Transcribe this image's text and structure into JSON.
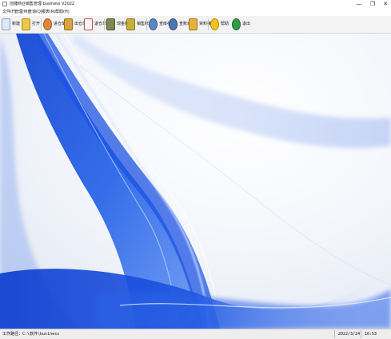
{
  "window": {
    "title": "创捷商业销售管理 business V2022",
    "minimize_glyph": "—",
    "maximize_glyph": "❐",
    "close_glyph": "✕"
  },
  "menu": [
    {
      "label": "文件(F)"
    },
    {
      "label": "管理(M)"
    },
    {
      "label": "查询(Q)"
    },
    {
      "label": "报表(R)"
    },
    {
      "label": "帮助(H)"
    }
  ],
  "toolbar": [
    {
      "label": "新建",
      "icon": "new-document-icon",
      "color": "#dfe8f5"
    },
    {
      "label": "打开",
      "icon": "open-folder-icon",
      "color": "#e8c94a"
    },
    {
      "label": "进仓单",
      "icon": "stock-in-icon",
      "color": "#e0863a"
    },
    {
      "label": "出仓单",
      "icon": "stock-out-icon",
      "color": "#d9a441"
    },
    {
      "label": "退仓单",
      "icon": "stock-return-icon",
      "color": "#c94848"
    },
    {
      "label": "现金账",
      "icon": "cash-ledger-icon",
      "color": "#7c8a52"
    },
    {
      "label": "销售账",
      "icon": "sales-ledger-icon",
      "color": "#c9b03a"
    },
    {
      "label": "查库存",
      "icon": "check-inventory-icon",
      "color": "#5b86c4"
    },
    {
      "label": "查账目",
      "icon": "check-accounts-icon",
      "color": "#4f74b3"
    },
    {
      "label": "资料簿",
      "icon": "records-book-icon",
      "color": "#e6b23a"
    },
    {
      "label": "帮助",
      "icon": "help-icon",
      "color": "#f2c318"
    },
    {
      "label": "退出",
      "icon": "exit-icon",
      "color": "#2f9c47"
    }
  ],
  "status": {
    "work_path": "工作路径：C:\\软件\\business",
    "date": "2022/3/24",
    "time": "10:53"
  }
}
